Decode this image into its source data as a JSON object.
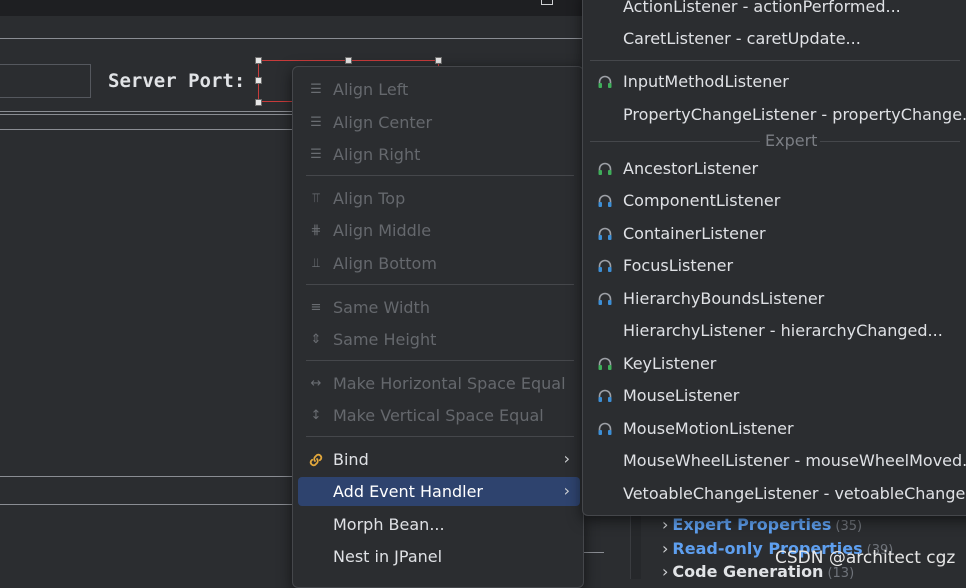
{
  "designer": {
    "server_port_label": "Server Port:"
  },
  "context_menu": {
    "items": [
      {
        "label": "Align Left",
        "icon": "align-left-icon",
        "enabled": false
      },
      {
        "label": "Align Center",
        "icon": "align-center-icon",
        "enabled": false
      },
      {
        "label": "Align Right",
        "icon": "align-right-icon",
        "enabled": false
      },
      {
        "label": "Align Top",
        "icon": "align-top-icon",
        "enabled": false
      },
      {
        "label": "Align Middle",
        "icon": "align-middle-icon",
        "enabled": false
      },
      {
        "label": "Align Bottom",
        "icon": "align-bottom-icon",
        "enabled": false
      },
      {
        "label": "Same Width",
        "icon": "same-width-icon",
        "enabled": false
      },
      {
        "label": "Same Height",
        "icon": "same-height-icon",
        "enabled": false
      },
      {
        "label": "Make Horizontal Space Equal",
        "icon": "horizontal-space-icon",
        "enabled": false
      },
      {
        "label": "Make Vertical Space Equal",
        "icon": "vertical-space-icon",
        "enabled": false
      },
      {
        "label": "Bind",
        "icon": "link-icon",
        "enabled": true,
        "submenu": true
      },
      {
        "label": "Add Event Handler",
        "icon": "",
        "enabled": true,
        "submenu": true,
        "selected": true
      },
      {
        "label": "Morph Bean...",
        "icon": "",
        "enabled": true
      },
      {
        "label": "Nest in JPanel",
        "icon": "",
        "enabled": true
      }
    ]
  },
  "event_submenu": {
    "separator_label": "Expert",
    "items": [
      {
        "label": "ActionListener - actionPerformed...",
        "icon": ""
      },
      {
        "label": "CaretListener - caretUpdate...",
        "icon": ""
      },
      {
        "label": "InputMethodListener",
        "icon": "listener-green-icon"
      },
      {
        "label": "PropertyChangeListener - propertyChange...",
        "icon": ""
      },
      {
        "label": "AncestorListener",
        "icon": "listener-green-icon"
      },
      {
        "label": "ComponentListener",
        "icon": "listener-blue-icon"
      },
      {
        "label": "ContainerListener",
        "icon": "listener-blue-icon"
      },
      {
        "label": "FocusListener",
        "icon": "listener-blue-icon"
      },
      {
        "label": "HierarchyBoundsListener",
        "icon": "listener-blue-icon"
      },
      {
        "label": "HierarchyListener - hierarchyChanged...",
        "icon": ""
      },
      {
        "label": "KeyListener",
        "icon": "listener-green-icon"
      },
      {
        "label": "MouseListener",
        "icon": "listener-blue-icon"
      },
      {
        "label": "MouseMotionListener",
        "icon": "listener-blue-icon"
      },
      {
        "label": "MouseWheelListener - mouseWheelMoved...",
        "icon": ""
      },
      {
        "label": "VetoableChangeListener - vetoableChange...",
        "icon": ""
      }
    ]
  },
  "properties": {
    "rows": [
      {
        "label": "Expert Properties",
        "count": "(35)"
      },
      {
        "label": "Read-only Properties",
        "count": "(39)"
      },
      {
        "label": "Code Generation",
        "count": "(13)"
      }
    ]
  },
  "watermark": "CSDN @architect cgz",
  "colors": {
    "accent_selected": "#2e436e",
    "link_blue": "#5e9fef",
    "listener_green": "#3fae5a",
    "listener_blue": "#3d8fd6"
  }
}
